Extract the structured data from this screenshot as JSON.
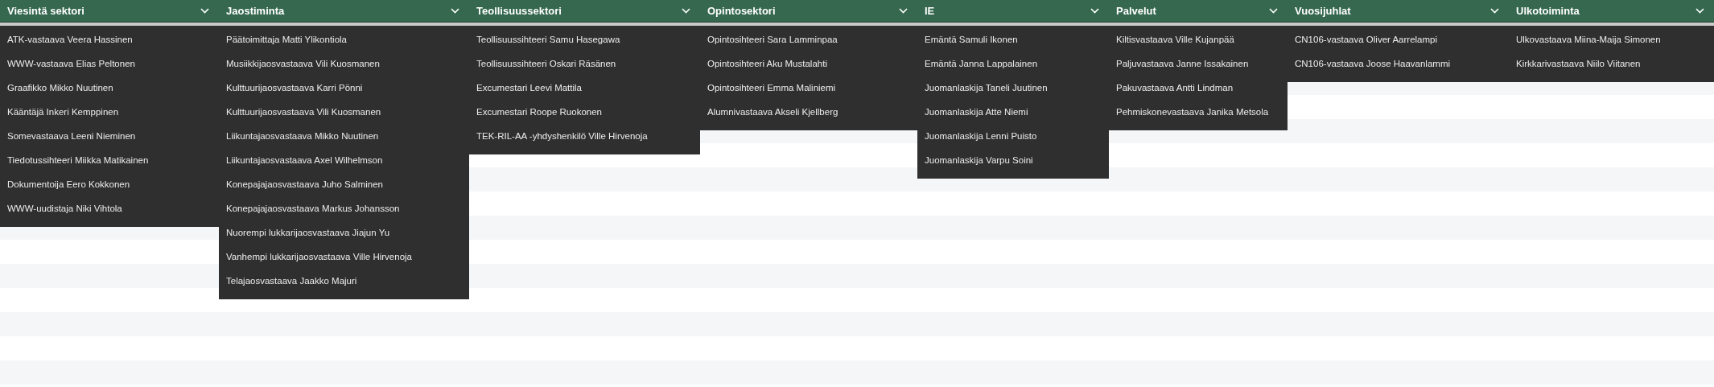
{
  "menus": [
    {
      "title": "Viesintä sektori",
      "items": [
        "ATK-vastaava Veera Hassinen",
        "WWW-vastaava Elias Peltonen",
        "Graafikko Mikko Nuutinen",
        "Kääntäjä Inkeri Kemppinen",
        "Somevastaava Leeni Nieminen",
        "Tiedotussihteeri Miikka Matikainen",
        "Dokumentoija Eero Kokkonen",
        "WWW-uudistaja Niki Vihtola"
      ]
    },
    {
      "title": "Jaostiminta",
      "items": [
        "Päätoimittaja Matti Ylikontiola",
        "Musiikkijaosvastaava Vili Kuosmanen",
        "Kulttuurijaosvastaava Karri Pönni",
        "Kulttuurijaosvastaava Vili Kuosmanen",
        "Liikuntajaosvastaava Mikko Nuutinen",
        "Liikuntajaosvastaava Axel Wilhelmson",
        "Konepajajaosvastaava Juho Salminen",
        "Konepajajaosvastaava Markus Johansson",
        "Nuorempi lukkarijaosvastaava Jiajun Yu",
        "Vanhempi lukkarijaosvastaava Ville Hirvenoja",
        "Telajaosvastaava Jaakko Majuri"
      ]
    },
    {
      "title": "Teollisuussektori",
      "items": [
        "Teollisuussihteeri Samu Hasegawa",
        "Teollisuussihteeri Oskari Räsänen",
        "Excumestari Leevi Mattila",
        "Excumestari Roope Ruokonen",
        "TEK-RIL-AA -yhdyshenkilö Ville Hirvenoja"
      ]
    },
    {
      "title": "Opintosektori",
      "items": [
        "Opintosihteeri Sara Lamminpaa",
        "Opintosihteeri Aku Mustalahti",
        "Opintosihteeri Emma Maliniemi",
        "Alumnivastaava Akseli Kjellberg"
      ]
    },
    {
      "title": "IE",
      "items": [
        "Emäntä Samuli Ikonen",
        "Emäntä Janna Lappalainen",
        "Juomanlaskija Taneli Juutinen",
        "Juomanlaskija Atte Niemi",
        "Juomanlaskija Lenni Puisto",
        "Juomanlaskija Varpu Soini"
      ]
    },
    {
      "title": "Palvelut",
      "items": [
        "Kiltisvastaava Ville Kujanpää",
        "Paljuvastaava Janne Issakainen",
        "Pakuvastaava Antti Lindman",
        "Pehmiskonevastaava Janika Metsola"
      ]
    },
    {
      "title": "Vuosijuhlat",
      "items": [
        "CN106-vastaava Oliver Aarrelampi",
        "CN106-vastaava Joose Haavanlammi"
      ]
    },
    {
      "title": "Ulkotoiminta",
      "items": [
        "Ulkovastaava Miina-Maija Simonen",
        "Kirkkarivastaava Niilo Viitanen"
      ]
    }
  ]
}
